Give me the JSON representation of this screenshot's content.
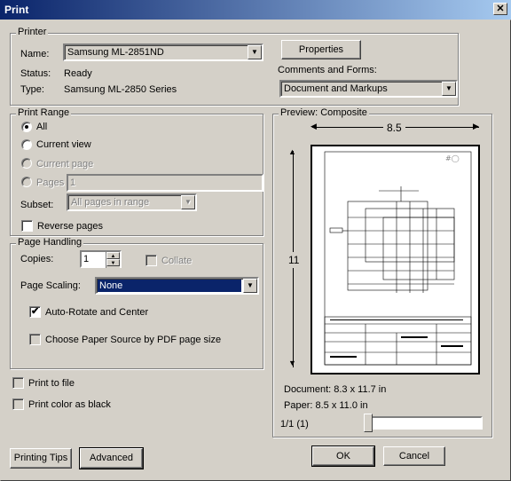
{
  "window": {
    "title": "Print",
    "close_glyph": "✕"
  },
  "printer": {
    "legend": "Printer",
    "name_label": "Name:",
    "name_value": "Samsung ML-2851ND",
    "status_label": "Status:",
    "status_value": "Ready",
    "type_label": "Type:",
    "type_value": "Samsung ML-2850 Series",
    "properties_button": "Properties",
    "comments_label": "Comments and Forms:",
    "comments_value": "Document and Markups"
  },
  "print_range": {
    "legend": "Print Range",
    "all": "All",
    "current_view": "Current view",
    "current_page": "Current page",
    "pages": "Pages",
    "pages_value": "1",
    "subset_label": "Subset:",
    "subset_value": "All pages in range",
    "reverse_pages": "Reverse pages"
  },
  "page_handling": {
    "legend": "Page Handling",
    "copies_label": "Copies:",
    "copies_value": "1",
    "collate": "Collate",
    "scaling_label": "Page Scaling:",
    "scaling_value": "None",
    "auto_rotate": "Auto-Rotate and Center",
    "choose_paper": "Choose Paper Source by PDF page size"
  },
  "options": {
    "print_to_file": "Print to file",
    "print_color_black": "Print color as black"
  },
  "preview": {
    "legend": "Preview: Composite",
    "width_dim": "8.5",
    "height_dim": "11",
    "document_size": "Document: 8.3 x 11.7 in",
    "paper_size": "Paper: 8.5 x 11.0 in",
    "page_indicator": "1/1 (1)"
  },
  "buttons": {
    "printing_tips": "Printing Tips",
    "advanced": "Advanced",
    "ok": "OK",
    "cancel": "Cancel"
  },
  "icons": {
    "dropdown": "▼",
    "spin_up": "▲",
    "spin_down": "▼",
    "check": "✔"
  }
}
